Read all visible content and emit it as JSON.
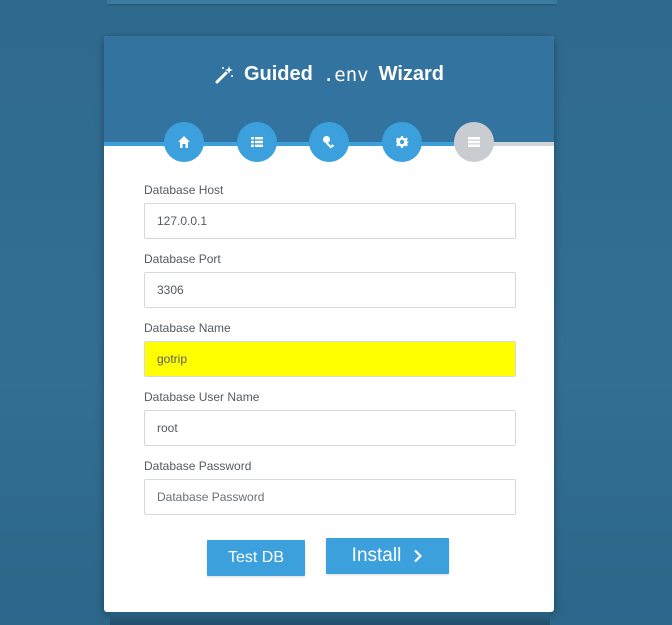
{
  "app": {
    "title_prefix": "Guided",
    "title_code": ".env",
    "title_suffix": "Wizard"
  },
  "steps": [
    {
      "icon": "home-icon",
      "state": "done"
    },
    {
      "icon": "list-icon",
      "state": "done"
    },
    {
      "icon": "key-icon",
      "state": "done"
    },
    {
      "icon": "gear-icon",
      "state": "done"
    },
    {
      "icon": "database-icon",
      "state": "inactive"
    }
  ],
  "form": {
    "db_host": {
      "label": "Database Host",
      "value": "127.0.0.1",
      "placeholder": ""
    },
    "db_port": {
      "label": "Database Port",
      "value": "3306",
      "placeholder": ""
    },
    "db_name": {
      "label": "Database Name",
      "value": "gotrip",
      "placeholder": ""
    },
    "db_user": {
      "label": "Database User Name",
      "value": "root",
      "placeholder": ""
    },
    "db_password": {
      "label": "Database Password",
      "value": "",
      "placeholder": "Database Password"
    }
  },
  "buttons": {
    "test_db": "Test DB",
    "install": "Install"
  },
  "colors": {
    "accent": "#3ba0dc",
    "header": "#3373a0",
    "background": "#326f93",
    "highlight": "#ffff00",
    "inactive_step": "#c9cdd1"
  }
}
